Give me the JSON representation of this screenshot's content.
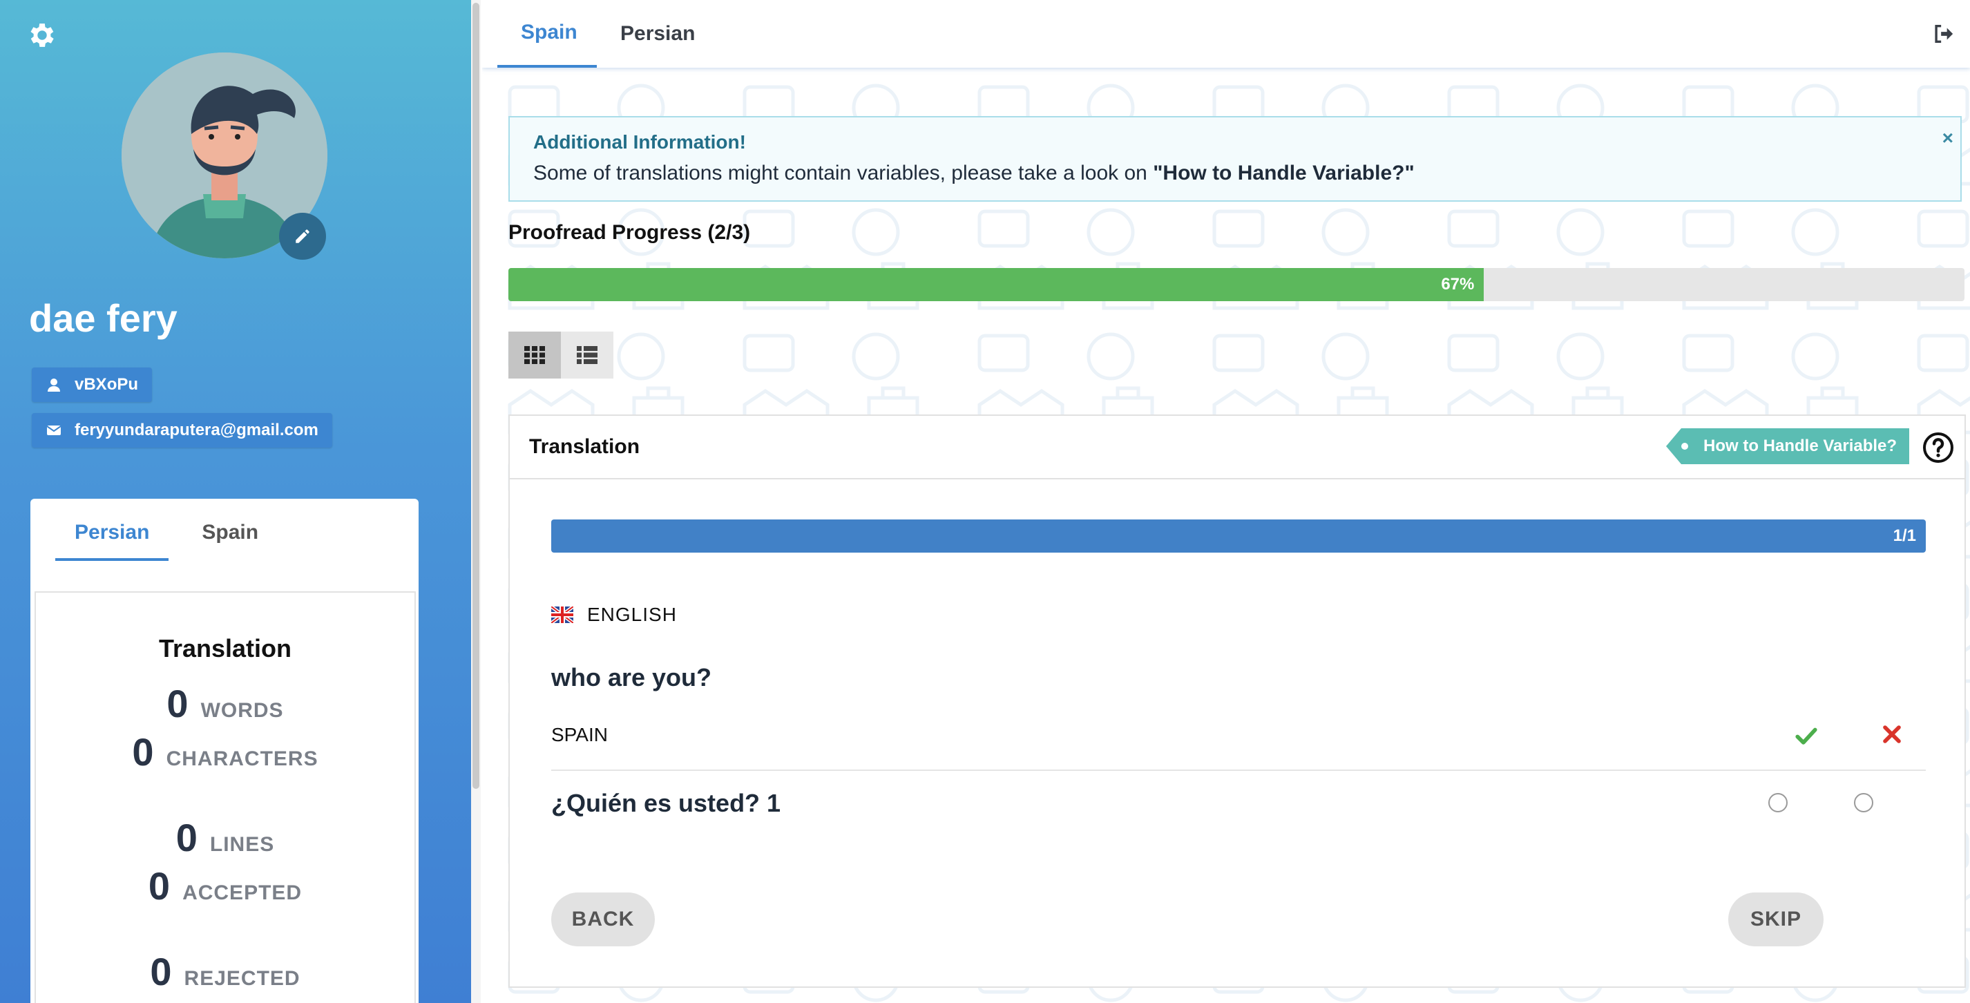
{
  "sidebar": {
    "user_name": "dae fery",
    "username": "vBXoPu",
    "email": "feryyundaraputera@gmail.com",
    "stats_tabs": [
      "Persian",
      "Spain"
    ],
    "stats_title": "Translation",
    "stats": [
      {
        "value": "0",
        "label": "WORDS"
      },
      {
        "value": "0",
        "label": "CHARACTERS"
      },
      {
        "value": "0",
        "label": "LINES"
      },
      {
        "value": "0",
        "label": "ACCEPTED"
      },
      {
        "value": "0",
        "label": "REJECTED"
      }
    ]
  },
  "topbar": {
    "tabs": [
      "Spain",
      "Persian"
    ],
    "active_tab": "Spain"
  },
  "info": {
    "title": "Additional Information!",
    "text_before": "Some of translations might contain variables, please take a look on ",
    "text_bold": "\"How to Handle Variable?\"",
    "close": "×"
  },
  "progress": {
    "label": "Proofread Progress (2/3)",
    "percent_label": "67%",
    "fraction": 0.67
  },
  "card": {
    "title": "Translation",
    "help_ribbon": "How to Handle Variable?",
    "segment_counter": "1/1",
    "source_language": "ENGLISH",
    "source_text": "who are you?",
    "target_language": "SPAIN",
    "translation_text": "¿Quién es usted? 1",
    "back_label": "BACK",
    "skip_label": "SKIP"
  },
  "colors": {
    "accent": "#3d86d1",
    "progress_fill": "#5cb85c",
    "accept": "#4cae4c",
    "reject": "#d9342b",
    "ribbon": "#5bbdb3"
  }
}
